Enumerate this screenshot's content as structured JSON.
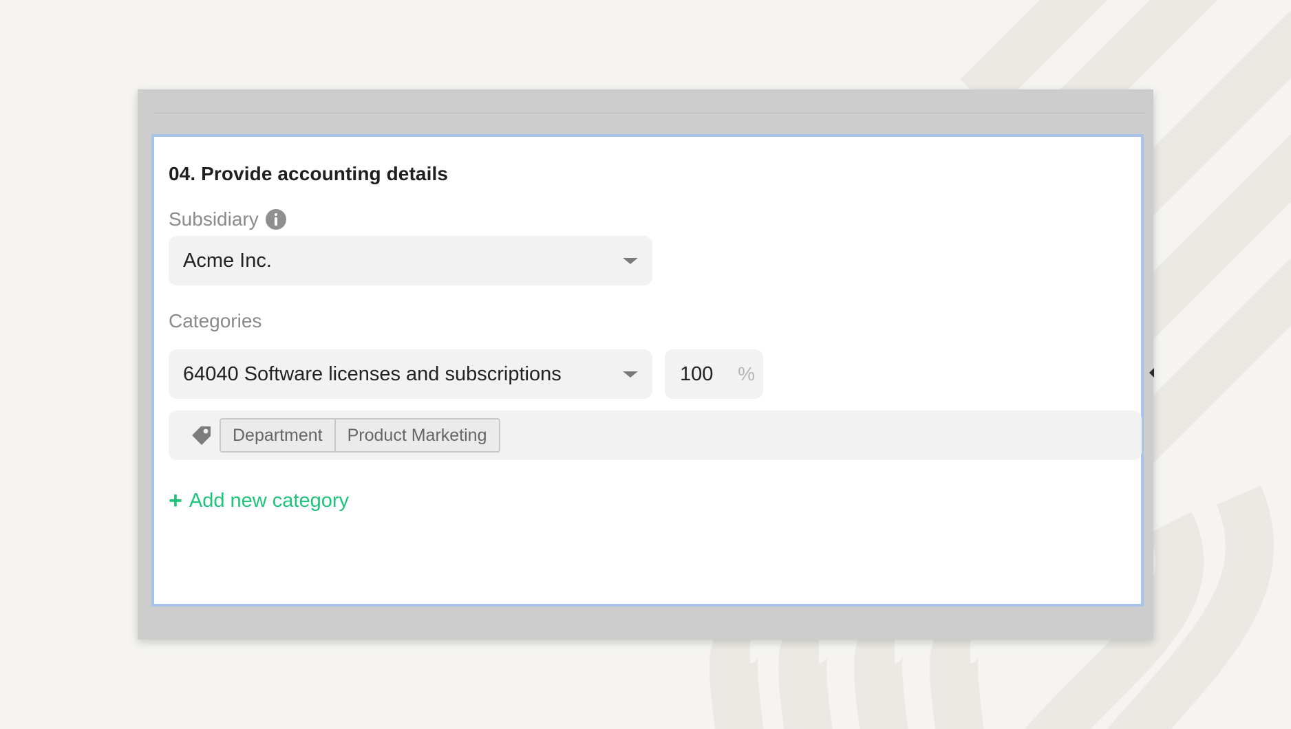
{
  "section": {
    "title": "04. Provide accounting details"
  },
  "subsidiary": {
    "label": "Subsidiary",
    "info_icon": "info-icon",
    "selected": "Acme Inc."
  },
  "categories": {
    "label": "Categories",
    "selected": "64040 Software licenses and subscriptions",
    "percent_value": "100",
    "percent_sign": "%"
  },
  "tag": {
    "icon": "tag-icon",
    "key": "Department",
    "value": "Product Marketing"
  },
  "actions": {
    "add_category_icon": "plus-icon",
    "add_category_label": "Add new category"
  },
  "colors": {
    "accent_green": "#1ec47a",
    "focus_border": "#a8c4ea"
  }
}
